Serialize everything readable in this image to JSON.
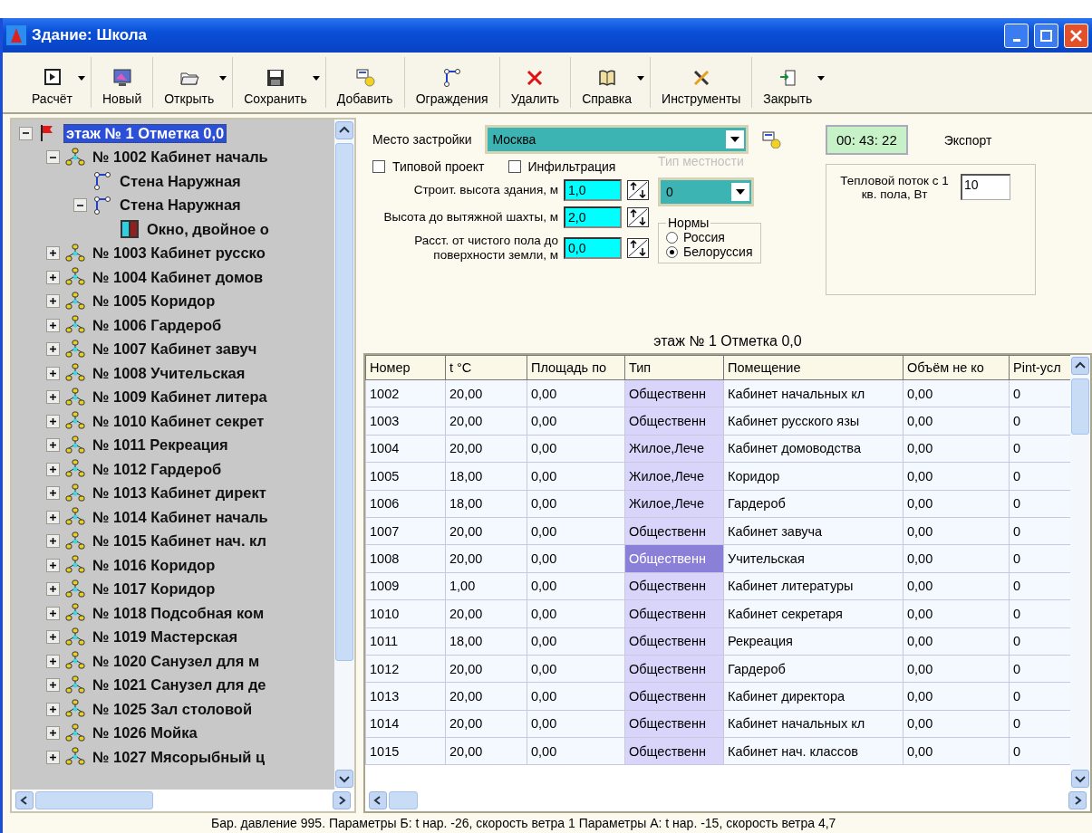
{
  "window": {
    "title": "Здание: Школа"
  },
  "toolbar": [
    {
      "label": "Расчёт",
      "kind": "calc",
      "dropdown": true
    },
    {
      "label": "Новый",
      "kind": "new",
      "dropdown": false
    },
    {
      "label": "Открыть",
      "kind": "open",
      "dropdown": true
    },
    {
      "label": "Сохранить",
      "kind": "save",
      "dropdown": true
    },
    {
      "label": "Добавить",
      "kind": "add",
      "dropdown": false
    },
    {
      "label": "Ограждения",
      "kind": "fence",
      "dropdown": false
    },
    {
      "label": "Удалить",
      "kind": "delete",
      "dropdown": false
    },
    {
      "label": "Справка",
      "kind": "help",
      "dropdown": true
    },
    {
      "label": "Инструменты",
      "kind": "tools",
      "dropdown": false
    },
    {
      "label": "Закрыть",
      "kind": "exit",
      "dropdown": true
    }
  ],
  "tree": [
    {
      "label": "этаж № 1 Отметка 0,0",
      "kind": "floor",
      "selected": true,
      "expanded": true,
      "children": [
        {
          "label": "№ 1002 Кабинет началь",
          "kind": "room",
          "selected": false,
          "expanded": true,
          "children": [
            {
              "label": "Стена Наружная",
              "kind": "wall",
              "selected": false
            },
            {
              "label": "Стена Наружная",
              "kind": "wall",
              "selected": false,
              "expanded": true,
              "children": [
                {
                  "label": "Окно, двойное о",
                  "kind": "window",
                  "selected": false
                }
              ]
            }
          ]
        },
        {
          "label": "№ 1003 Кабинет русско",
          "kind": "room",
          "selected": false,
          "expanded": false
        },
        {
          "label": "№ 1004 Кабинет домов",
          "kind": "room",
          "selected": false,
          "expanded": false
        },
        {
          "label": "№ 1005 Коридор",
          "kind": "room",
          "selected": false,
          "expanded": false
        },
        {
          "label": "№ 1006 Гардероб",
          "kind": "room",
          "selected": false,
          "expanded": false
        },
        {
          "label": "№ 1007 Кабинет завуч",
          "kind": "room",
          "selected": false,
          "expanded": false
        },
        {
          "label": "№ 1008 Учительская",
          "kind": "room",
          "selected": false,
          "expanded": false
        },
        {
          "label": "№ 1009 Кабинет литера",
          "kind": "room",
          "selected": false,
          "expanded": false
        },
        {
          "label": "№ 1010 Кабинет секрет",
          "kind": "room",
          "selected": false,
          "expanded": false
        },
        {
          "label": "№ 1011 Рекреация",
          "kind": "room",
          "selected": false,
          "expanded": false
        },
        {
          "label": "№ 1012 Гардероб",
          "kind": "room",
          "selected": false,
          "expanded": false
        },
        {
          "label": "№ 1013 Кабинет директ",
          "kind": "room",
          "selected": false,
          "expanded": false
        },
        {
          "label": "№ 1014 Кабинет началь",
          "kind": "room",
          "selected": false,
          "expanded": false
        },
        {
          "label": "№ 1015 Кабинет нач. кл",
          "kind": "room",
          "selected": false,
          "expanded": false
        },
        {
          "label": "№ 1016 Коридор",
          "kind": "room",
          "selected": false,
          "expanded": false
        },
        {
          "label": "№ 1017 Коридор",
          "kind": "room",
          "selected": false,
          "expanded": false
        },
        {
          "label": "№ 1018 Подсобная ком",
          "kind": "room",
          "selected": false,
          "expanded": false
        },
        {
          "label": "№ 1019 Мастерская",
          "kind": "room",
          "selected": false,
          "expanded": false
        },
        {
          "label": "№ 1020 Санузел для м",
          "kind": "room",
          "selected": false,
          "expanded": false
        },
        {
          "label": "№ 1021 Санузел для де",
          "kind": "room",
          "selected": false,
          "expanded": false
        },
        {
          "label": "№ 1025 Зал столовой",
          "kind": "room",
          "selected": false,
          "expanded": false
        },
        {
          "label": "№ 1026 Мойка",
          "kind": "room",
          "selected": false,
          "expanded": false
        },
        {
          "label": "№ 1027 Мясорыбный ц",
          "kind": "room",
          "selected": false,
          "expanded": false
        }
      ]
    }
  ],
  "form": {
    "location_label": "Место застройки",
    "location": "Москва",
    "timer": "00: 43: 22",
    "export_label": "Экспорт",
    "checkboxes": [
      {
        "label": "Типовой проект",
        "checked": false
      },
      {
        "label": "Инфильтрация",
        "checked": false
      }
    ],
    "terrain": {
      "label": "Тип местности",
      "disabled": true,
      "value": "0"
    },
    "spinners": [
      {
        "label": "Строит. высота здания, м",
        "value": "1,0"
      },
      {
        "label": "Высота  до вытяжной шахты,  м",
        "value": "2,0"
      },
      {
        "label": "Расст. от чистого пола до поверхности  земли, м",
        "value": "0,0"
      }
    ],
    "norms": {
      "title": "Нормы",
      "options": [
        {
          "label": "Россия",
          "selected": false
        },
        {
          "label": "Белоруссия",
          "selected": true
        }
      ]
    },
    "heat_flow": {
      "label": "Тепловой поток с 1 кв. пола, Вт",
      "value": "10"
    },
    "caption": "этаж № 1 Отметка 0,0"
  },
  "table": {
    "columns": [
      "Номер",
      "t °C",
      "Площадь по",
      "Тип",
      "Помещение",
      "Объём не ко",
      "Pint-усл"
    ],
    "rows": [
      {
        "selected": false,
        "cells": [
          "1002",
          "20,00",
          "0,00",
          "Общественн",
          "Кабинет начальных кл",
          "0,00",
          "0"
        ]
      },
      {
        "selected": false,
        "cells": [
          "1003",
          "20,00",
          "0,00",
          "Общественн",
          "Кабинет русского язы",
          "0,00",
          "0"
        ]
      },
      {
        "selected": false,
        "cells": [
          "1004",
          "20,00",
          "0,00",
          "Жилое,Лече",
          "Кабинет домоводства",
          "0,00",
          "0"
        ]
      },
      {
        "selected": false,
        "cells": [
          "1005",
          "18,00",
          "0,00",
          "Жилое,Лече",
          "Коридор",
          "0,00",
          "0"
        ]
      },
      {
        "selected": false,
        "cells": [
          "1006",
          "18,00",
          "0,00",
          "Жилое,Лече",
          "Гардероб",
          "0,00",
          "0"
        ]
      },
      {
        "selected": false,
        "cells": [
          "1007",
          "20,00",
          "0,00",
          "Общественн",
          "Кабинет завуча",
          "0,00",
          "0"
        ]
      },
      {
        "selected": true,
        "cells": [
          "1008",
          "20,00",
          "0,00",
          "Общественн",
          "Учительская",
          "0,00",
          "0"
        ]
      },
      {
        "selected": false,
        "cells": [
          "1009",
          "1,00",
          "0,00",
          "Общественн",
          "Кабинет литературы",
          "0,00",
          "0"
        ]
      },
      {
        "selected": false,
        "cells": [
          "1010",
          "20,00",
          "0,00",
          "Общественн",
          "Кабинет секретаря",
          "0,00",
          "0"
        ]
      },
      {
        "selected": false,
        "cells": [
          "1011",
          "18,00",
          "0,00",
          "Общественн",
          "Рекреация",
          "0,00",
          "0"
        ]
      },
      {
        "selected": false,
        "cells": [
          "1012",
          "20,00",
          "0,00",
          "Общественн",
          "Гардероб",
          "0,00",
          "0"
        ]
      },
      {
        "selected": false,
        "cells": [
          "1013",
          "20,00",
          "0,00",
          "Общественн",
          "Кабинет директора",
          "0,00",
          "0"
        ]
      },
      {
        "selected": false,
        "cells": [
          "1014",
          "20,00",
          "0,00",
          "Общественн",
          "Кабинет начальных кл",
          "0,00",
          "0"
        ]
      },
      {
        "selected": false,
        "cells": [
          "1015",
          "20,00",
          "0,00",
          "Общественн",
          "Кабинет нач. классов",
          "0,00",
          "0"
        ]
      }
    ]
  },
  "status_bar": "Бар. давление 995. Параметры Б: t нар. -26, скорость ветра 1    Параметры А: t нар. -15, скорость ветра 4,7"
}
